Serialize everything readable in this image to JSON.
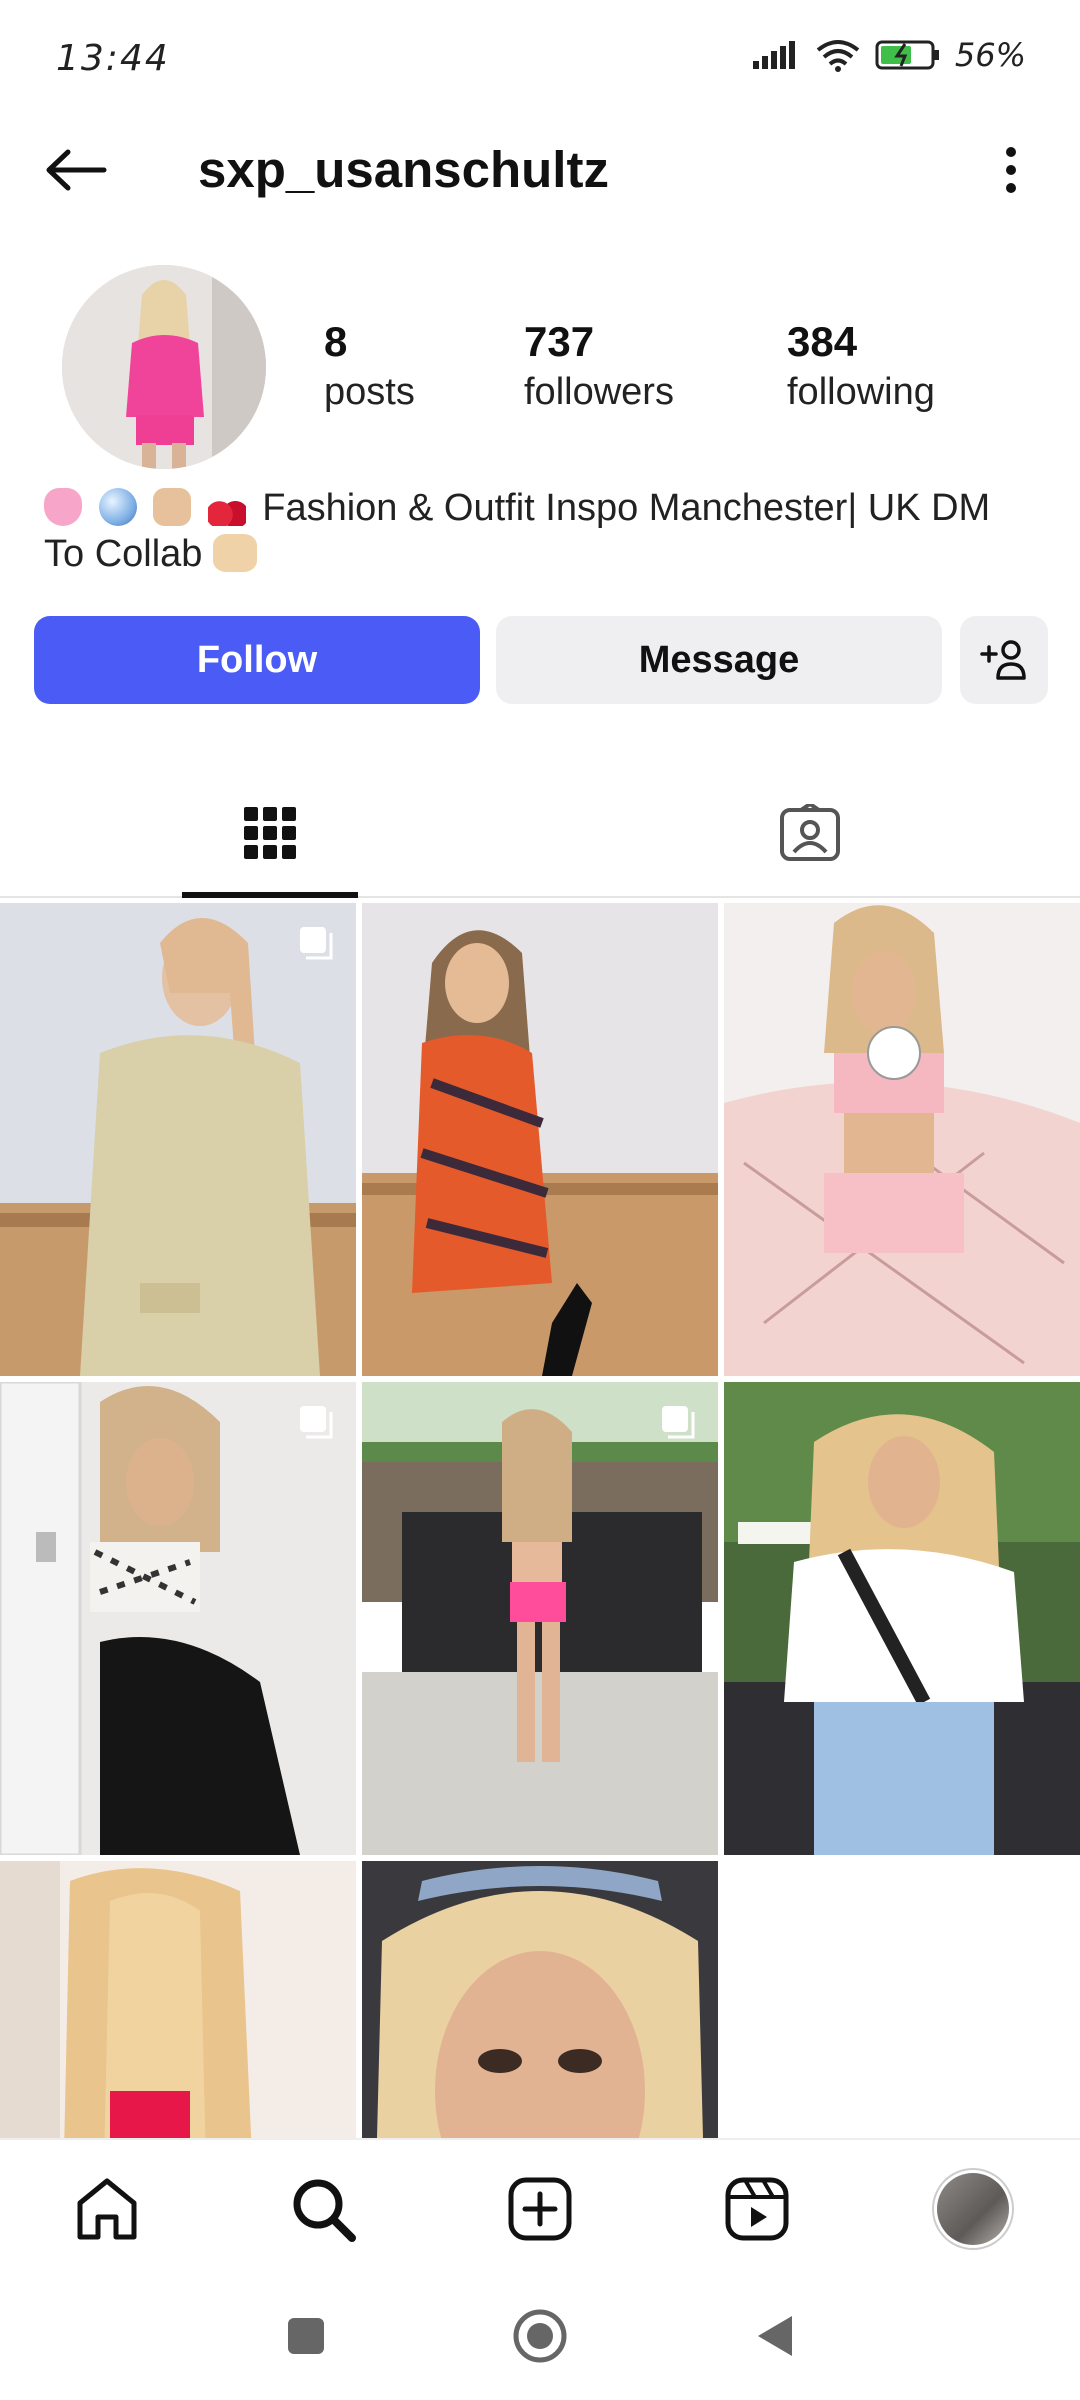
{
  "status_bar": {
    "time": "13:44",
    "battery": "56%"
  },
  "header": {
    "username": "sxp_usanschultz"
  },
  "profile": {
    "stats": [
      {
        "value": "8",
        "label": "posts"
      },
      {
        "value": "737",
        "label": "followers"
      },
      {
        "value": "384",
        "label": "following"
      }
    ],
    "bio_line1": "Fashion & Outfit Inspo Manchester| UK DM",
    "bio_line2": "To Collab"
  },
  "actions": {
    "follow": "Follow",
    "message": "Message"
  },
  "tabs": [
    {
      "icon": "grid-icon",
      "active": true
    },
    {
      "icon": "tagged-icon",
      "active": false
    }
  ],
  "posts": [
    {
      "id": 1,
      "multi": true
    },
    {
      "id": 2,
      "multi": false
    },
    {
      "id": 3,
      "multi": false
    },
    {
      "id": 4,
      "multi": true
    },
    {
      "id": 5,
      "multi": true
    },
    {
      "id": 6,
      "multi": false
    },
    {
      "id": 7,
      "multi": false
    },
    {
      "id": 8,
      "multi": false
    }
  ],
  "bottom_nav": [
    "home-icon",
    "search-icon",
    "create-icon",
    "reels-icon",
    "profile-avatar"
  ],
  "colors": {
    "accent": "#4a5cf5",
    "secondary_button": "#efeff2"
  }
}
